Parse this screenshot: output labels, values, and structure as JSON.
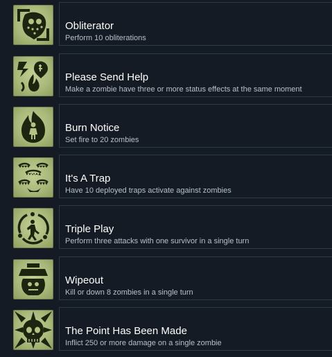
{
  "achievements": [
    {
      "title": "Obliterator",
      "description": "Perform 10 obliterations",
      "icon": "skull-hockey-mask-icon"
    },
    {
      "title": "Please Send Help",
      "description": "Make a zombie have three or more status effects at the same moment",
      "icon": "status-effects-icon"
    },
    {
      "title": "Burn Notice",
      "description": "Set fire to 20 zombies",
      "icon": "burning-zombie-icon"
    },
    {
      "title": "It's A Trap",
      "description": "Have 10 deployed traps activate against zombies",
      "icon": "bear-trap-icon"
    },
    {
      "title": "Triple Play",
      "description": "Perform three attacks with one survivor in a single turn",
      "icon": "triple-attack-icon"
    },
    {
      "title": "Wipeout",
      "description": "Kill or down 8 zombies in a single turn",
      "icon": "wipeout-icon"
    },
    {
      "title": "The Point Has Been Made",
      "description": "Inflict 250 or more damage on a single zombie",
      "icon": "spiked-skull-icon"
    }
  ],
  "colors": {
    "background": "#141b24",
    "icon_tile": "#b4c283",
    "title_text": "#ffffff",
    "description_text": "#b7c0c8"
  }
}
